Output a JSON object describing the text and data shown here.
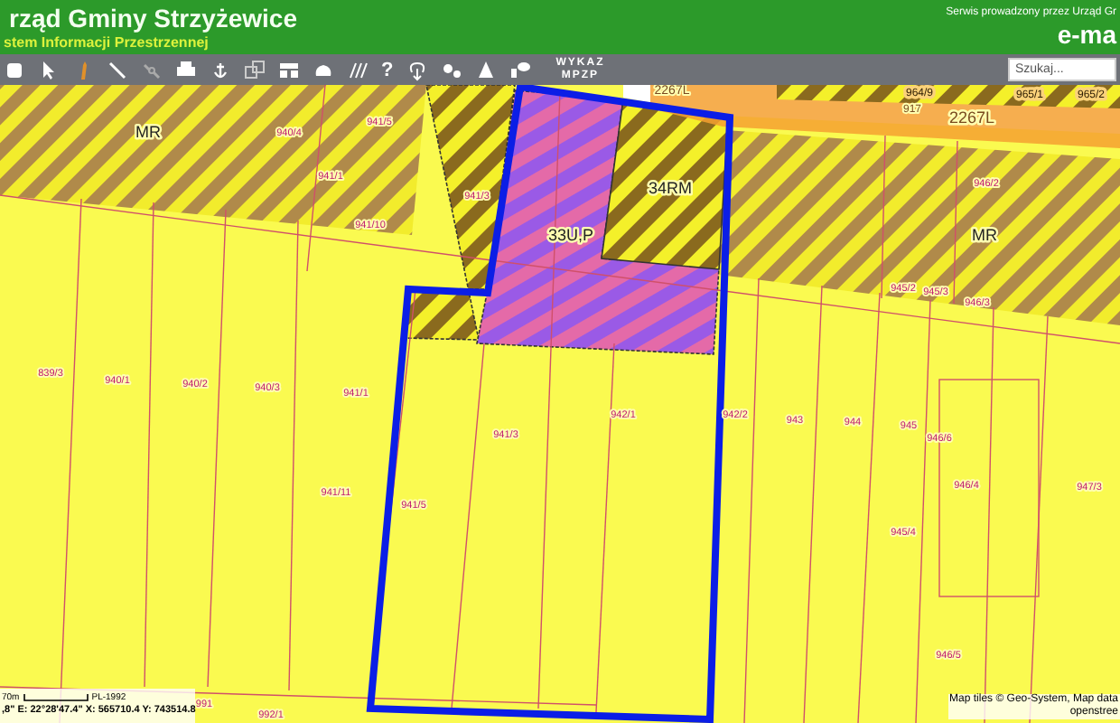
{
  "header": {
    "title": "rząd Gminy Strzyżewice",
    "subtitle": "stem Informacji Przestrzennej",
    "service_note": "Serwis prowadzony przez Urząd Gr",
    "email_label": "e-ma"
  },
  "toolbar": {
    "help_glyph": "?",
    "wykaz_button": [
      "WYKAZ",
      "MPZP"
    ],
    "search": {
      "placeholder": "Szukaj..."
    }
  },
  "map": {
    "zone_labels": [
      "MR",
      "34RM",
      "33U,P",
      "MR"
    ],
    "road_labels": [
      "2267L",
      "2267L",
      "917"
    ],
    "parcel_labels": [
      "940/4",
      "941/5",
      "941/1",
      "941/10",
      "941/3",
      "964/9",
      "965/1",
      "965/2",
      "946/2",
      "945/2",
      "945/3",
      "946/3",
      "839/3",
      "940/1",
      "940/2",
      "940/3",
      "941/1",
      "941/3",
      "942/1",
      "942/2",
      "943",
      "944",
      "945",
      "946/6",
      "946/4",
      "947/3",
      "945/4",
      "941/11",
      "941/5",
      "946/5",
      "991",
      "992/1"
    ],
    "scale": "70m",
    "crs": "PL-1992",
    "coordinates": ",8\" E: 22°28'47.4\" X: 565710.4 Y: 743514.8",
    "attribution": [
      "Map tiles © Geo-System, Map data",
      "openstree"
    ]
  }
}
